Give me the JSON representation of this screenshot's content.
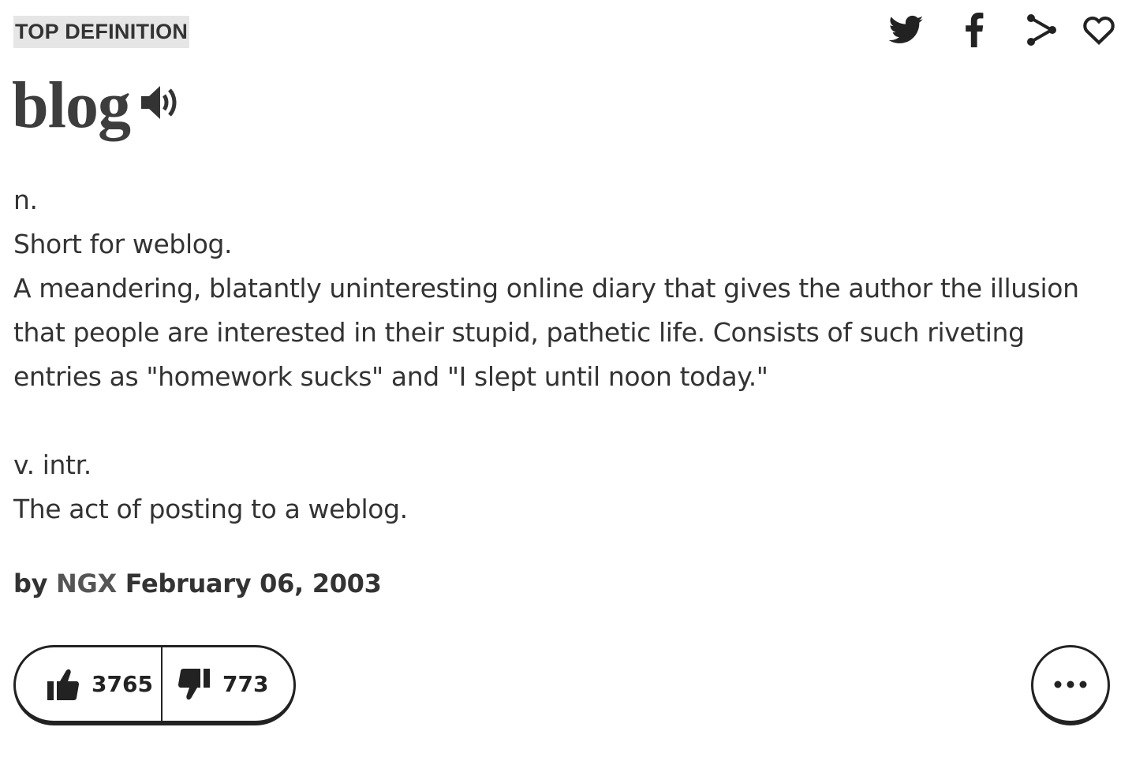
{
  "badge": "TOP DEFINITION",
  "share_icons": [
    "twitter-icon",
    "facebook-icon",
    "share-icon",
    "heart-icon"
  ],
  "word": "blog",
  "meaning_lines": [
    "n.",
    "Short for weblog.",
    "A meandering, blatantly uninteresting online diary that gives the author the illusion",
    "that people are interested in their stupid, pathetic life. Consists of such riveting",
    "entries as \"homework sucks\" and \"I slept until noon today.\"",
    "",
    "v. intr.",
    "The act of posting to a weblog."
  ],
  "contributor": {
    "by": "by",
    "author": "NGX",
    "date": "February 06, 2003"
  },
  "votes": {
    "up": "3765",
    "down": "773"
  },
  "more_icon": "ellipsis-icon"
}
